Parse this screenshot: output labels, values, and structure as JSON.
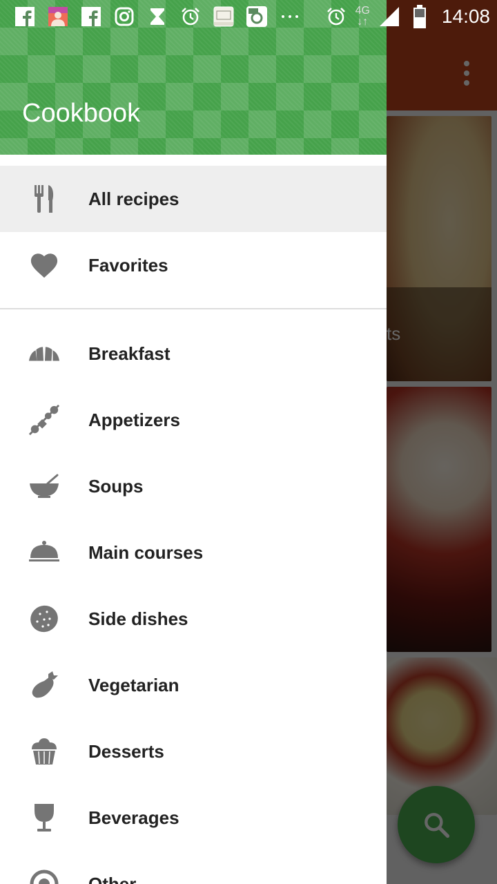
{
  "status_bar": {
    "time": "14:08",
    "network": "4G",
    "notification_icons": [
      "facebook-icon",
      "instagram-profile-icon",
      "facebook-icon",
      "instagram-icon",
      "hourglass-icon",
      "alarm-icon",
      "bible-icon",
      "og-instagram-icon",
      "more-notifications-icon"
    ],
    "system_icons": [
      "alarm-icon",
      "signal-icon",
      "battery-icon"
    ]
  },
  "drawer": {
    "title": "Cookbook",
    "header_color": "#46a24b",
    "primary_items": [
      {
        "label": "All recipes",
        "icon": "fork-knife-icon",
        "active": true
      },
      {
        "label": "Favorites",
        "icon": "heart-icon",
        "active": false
      }
    ],
    "category_items": [
      {
        "label": "Breakfast",
        "icon": "croissant-icon"
      },
      {
        "label": "Appetizers",
        "icon": "skewer-icon"
      },
      {
        "label": "Soups",
        "icon": "soup-bowl-icon"
      },
      {
        "label": "Main courses",
        "icon": "cloche-icon"
      },
      {
        "label": "Side dishes",
        "icon": "potato-icon"
      },
      {
        "label": "Vegetarian",
        "icon": "eggplant-icon"
      },
      {
        "label": "Desserts",
        "icon": "cupcake-icon"
      },
      {
        "label": "Beverages",
        "icon": "wine-glass-icon"
      },
      {
        "label": "Other",
        "icon": "other-icon"
      }
    ]
  },
  "background_app": {
    "toolbar_color": "#c0441c",
    "card_caption_fragment": "ts",
    "fab_icon": "search-icon",
    "fab_color": "#4caf50"
  },
  "colors": {
    "icon_gray": "#757575",
    "active_item_bg": "#eeeeee"
  }
}
